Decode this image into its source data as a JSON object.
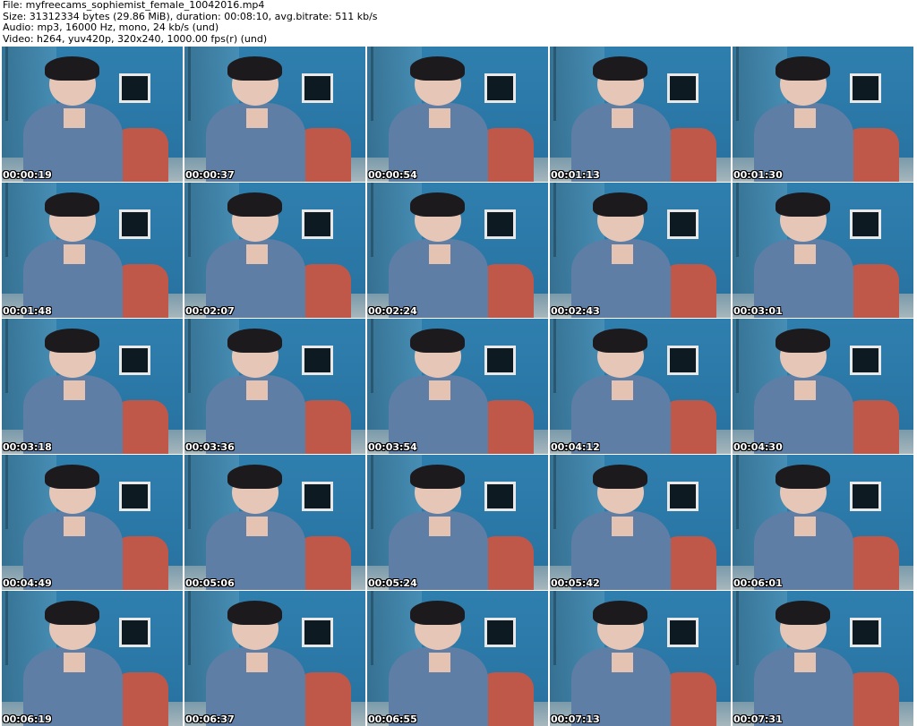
{
  "header": {
    "file": "File: myfreecams_sophiemist_female_10042016.mp4",
    "size": "Size: 31312334 bytes (29.86 MiB), duration: 00:08:10, avg.bitrate: 511 kb/s",
    "audio": "Audio: mp3, 16000 Hz, mono, 24 kb/s (und)",
    "video": "Video: h264, yuv420p, 320x240, 1000.00 fps(r) (und)"
  },
  "thumbnails": [
    {
      "timestamp": "00:00:19"
    },
    {
      "timestamp": "00:00:37"
    },
    {
      "timestamp": "00:00:54"
    },
    {
      "timestamp": "00:01:13"
    },
    {
      "timestamp": "00:01:30"
    },
    {
      "timestamp": "00:01:48"
    },
    {
      "timestamp": "00:02:07"
    },
    {
      "timestamp": "00:02:24"
    },
    {
      "timestamp": "00:02:43"
    },
    {
      "timestamp": "00:03:01"
    },
    {
      "timestamp": "00:03:18"
    },
    {
      "timestamp": "00:03:36"
    },
    {
      "timestamp": "00:03:54"
    },
    {
      "timestamp": "00:04:12"
    },
    {
      "timestamp": "00:04:30"
    },
    {
      "timestamp": "00:04:49"
    },
    {
      "timestamp": "00:05:06"
    },
    {
      "timestamp": "00:05:24"
    },
    {
      "timestamp": "00:05:42"
    },
    {
      "timestamp": "00:06:01"
    },
    {
      "timestamp": "00:06:19"
    },
    {
      "timestamp": "00:06:37"
    },
    {
      "timestamp": "00:06:55"
    },
    {
      "timestamp": "00:07:13"
    },
    {
      "timestamp": "00:07:31"
    }
  ]
}
